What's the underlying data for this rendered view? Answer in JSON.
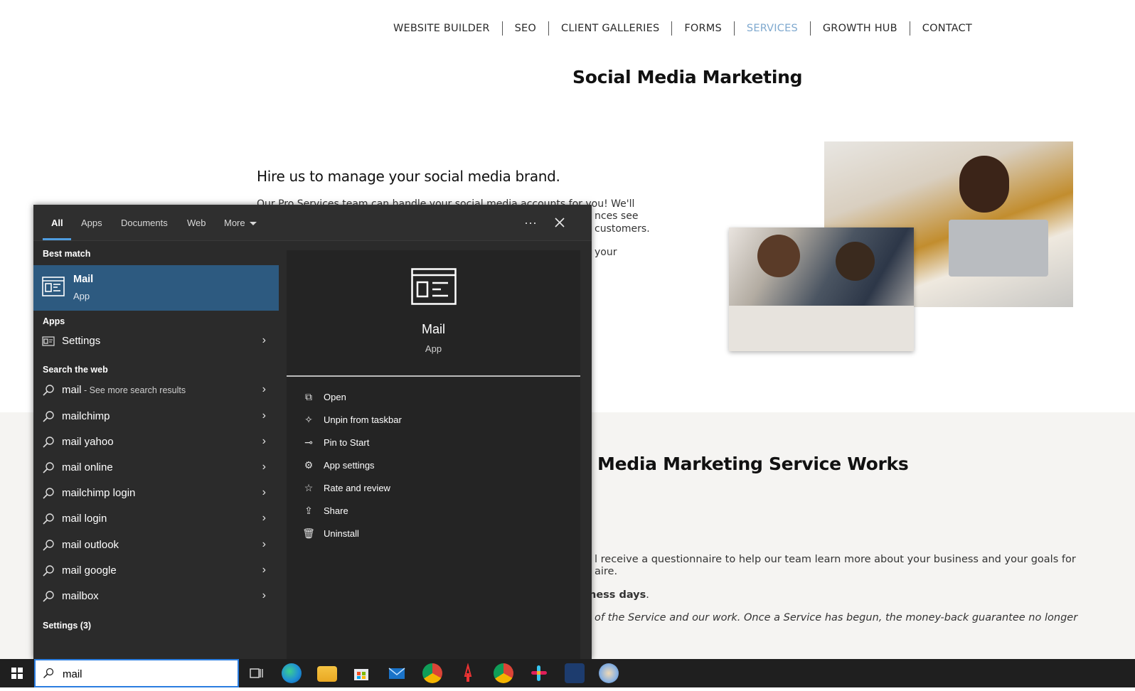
{
  "website": {
    "nav": [
      "WEBSITE BUILDER",
      "SEO",
      "CLIENT GALLERIES",
      "FORMS",
      "SERVICES",
      "GROWTH HUB",
      "CONTACT"
    ],
    "active_nav": "SERVICES",
    "page_title": "Social Media Marketing",
    "hire_title": "Hire us to manage your social media brand.",
    "intro_line1": "Our Pro Services team can handle your social media accounts for you! We'll",
    "intro_line2": "nces see",
    "intro_line3": "customers.",
    "intro_line4": "your",
    "works_title": "Media Marketing Service Works",
    "works_line1": "l receive a questionnaire to help our team learn more about your business and your goals for",
    "works_line2": "aire.",
    "works_line3_bold": "ness days",
    "works_line3_tail": ".",
    "works_line4": "of the Service and our work. Once a Service has begun, the money-back guarantee no longer"
  },
  "search_flyout": {
    "tabs": [
      "All",
      "Apps",
      "Documents",
      "Web",
      "More"
    ],
    "active_tab": "All",
    "best_match_label": "Best match",
    "best_match": {
      "title": "Mail",
      "subtitle": "App"
    },
    "apps_label": "Apps",
    "apps": [
      {
        "label": "Settings"
      }
    ],
    "web_label": "Search the web",
    "web_first": {
      "query": "mail",
      "suffix": " - See more search results"
    },
    "web_results": [
      "mailchimp",
      "mail yahoo",
      "mail online",
      "mailchimp login",
      "mail login",
      "mail outlook",
      "mail google",
      "mailbox"
    ],
    "settings_label": "Settings (3)",
    "detail": {
      "title": "Mail",
      "subtitle": "App",
      "actions": [
        "Open",
        "Unpin from taskbar",
        "Pin to Start",
        "App settings",
        "Rate and review",
        "Share",
        "Uninstall"
      ]
    }
  },
  "taskbar": {
    "search_value": "mail",
    "icons": [
      "task-view-icon",
      "edge-icon",
      "file-explorer-icon",
      "store-icon",
      "mail-icon",
      "chrome-icon",
      "acrobat-icon",
      "chrome-profile-icon",
      "slack-icon",
      "phone-app-icon",
      "paint-icon"
    ]
  },
  "colors": {
    "accent": "#2d5a80",
    "tab_indicator": "#4f9de0",
    "nav_active": "#7fa9cf"
  }
}
